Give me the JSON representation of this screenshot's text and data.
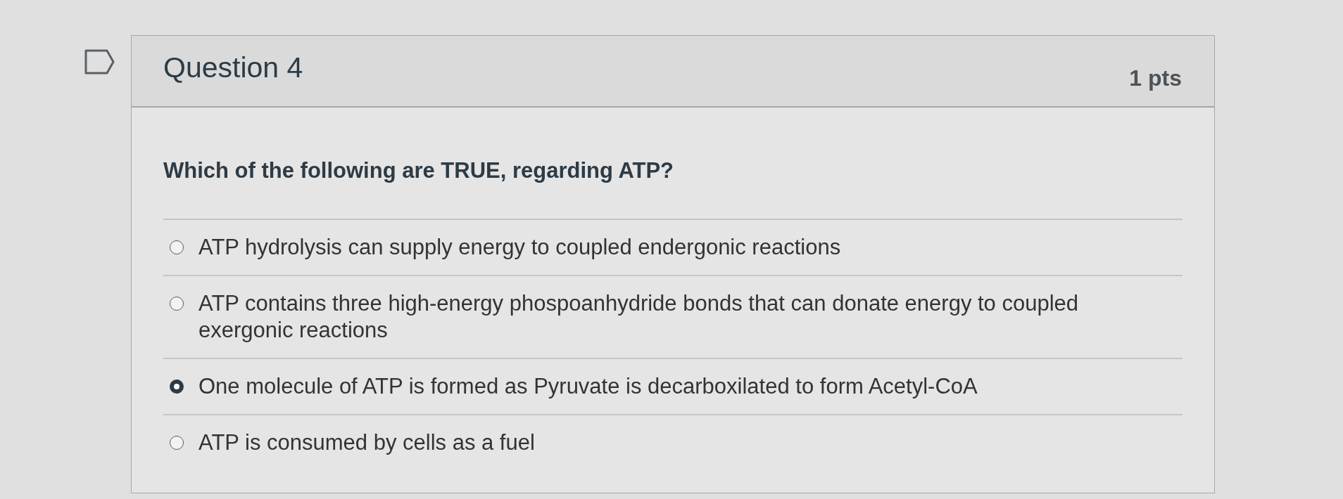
{
  "question": {
    "title": "Question 4",
    "points": "1 pts",
    "prompt": "Which of the following are TRUE, regarding ATP?"
  },
  "answers": [
    {
      "label": "ATP hydrolysis can supply energy to coupled endergonic reactions",
      "selected": false
    },
    {
      "label": "ATP contains three high-energy phospoanhydride bonds that can donate energy to coupled exergonic reactions",
      "selected": false
    },
    {
      "label": "One molecule of ATP is formed as Pyruvate is decarboxilated to form Acetyl-CoA",
      "selected": true
    },
    {
      "label": "ATP is consumed by cells as a fuel",
      "selected": false
    }
  ]
}
